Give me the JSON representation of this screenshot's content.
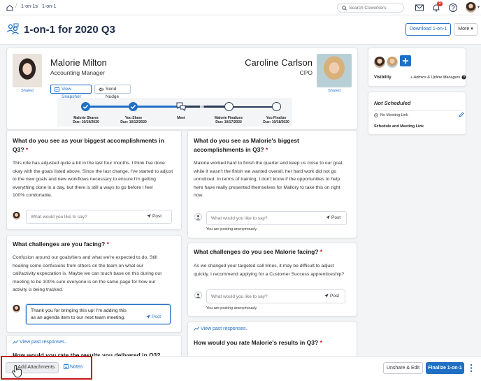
{
  "breadcrumb": {
    "items": [
      "1-on-1s",
      "1-on-1"
    ],
    "separator": "/"
  },
  "topbar": {
    "search_placeholder": "Search Coworkers",
    "notification_count": "2"
  },
  "page": {
    "title": "1-on-1 for 2020 Q3",
    "download_label": "Download 1-on-1",
    "more_label": "More"
  },
  "participants": {
    "left": {
      "name": "Malorie Milton",
      "role": "Accounting Manager",
      "shared_label": "Shared",
      "view_snapshot_label": "View Snapshot",
      "send_nudge_label": "Send Nudge"
    },
    "right": {
      "name": "Caroline Carlson",
      "role": "CPO",
      "shared_label": "Shared"
    }
  },
  "steps": [
    {
      "label": "Malorie Shares",
      "due": "Due: 10/19/2020",
      "state": "done"
    },
    {
      "label": "You Share",
      "due": "Due: 10/12/2020",
      "state": "done"
    },
    {
      "label": "Meet",
      "due": "",
      "state": "current"
    },
    {
      "label": "Malorie Finalizes",
      "due": "Due: 10/17/2020",
      "state": "todo"
    },
    {
      "label": "You Finalize",
      "due": "Due: 10/18/2020",
      "state": "todo"
    }
  ],
  "sidebar": {
    "visibility_label": "Visibility",
    "visibility_value": "+ Admins & Upline Managers",
    "not_scheduled_title": "Not Scheduled",
    "no_meeting_link": "No Meeting Link",
    "schedule_link_label": "Schedule and Meeting Link"
  },
  "left_column": {
    "q1": {
      "title_line1": "What do you see as your biggest accomplishments in",
      "title_line2": "Q3?",
      "required_mark": "*",
      "answer_lines": [
        "This role has adjusted quite a bit in the last four months. I think I've done",
        "okay with the goals listed above. Since the last change, I've started to adjust",
        "to the new goals and new workflows necessary to ensure I'm getting",
        "everything done in a day, but there is still a ways to go before I feel",
        "100% comfortable."
      ],
      "comment_placeholder": "What would you like to say?",
      "post_label": "Post"
    },
    "q2": {
      "title": "What challenges are you facing?",
      "required_mark": "*",
      "answer_lines": [
        "Confusion around our goals/tiers and what we're expected to do. Still",
        "hearing some confusions from others on the team on what our",
        "call/activity expectation is. Maybe we can touch base on this during our",
        "meeting to be 100% sure everyone is on the same page for how our",
        "activity is being tracked."
      ],
      "comment_lines": [
        "Thank you for bringing this up! I'm adding this",
        "as an agenda item to our next team meeting."
      ],
      "post_label": "Post"
    },
    "view_past_label": "View past responses.",
    "q3_title": "How would you rate the results you delivered in Q3?"
  },
  "right_column": {
    "q1": {
      "title_line1": "What do you see as Malorie's biggest",
      "title_line2": "accomplishments in Q3?",
      "required_mark": "*",
      "answer_lines": [
        "Malorie worked hard to finish the quarter and keep us close to our goal,",
        "while it wasn't the finish we wanted overall, her hard work did not go",
        "unnoticed. In terms of training, I don't know if the opportunities to help",
        "here have really presented themselves for Mallory to take this on right",
        "now."
      ],
      "comment_placeholder": "What would you like to say?",
      "post_label": "Post",
      "anon_note": "You are posting anonymously."
    },
    "q2": {
      "title": "What challenges do you see Malorie facing?",
      "required_mark": "*",
      "answer_lines": [
        "As we changed your targeted call times, it may be difficult to adjust",
        "quickly. I recommend applying for a Customer Success apprenticeship?"
      ],
      "comment_placeholder": "What would you like to say?",
      "post_label": "Post",
      "anon_note": "You are posting anonymously."
    },
    "view_past_label": "View past responses.",
    "q3_title": "How would you rate Malorie's results in Q3?",
    "q3_required_mark": "*"
  },
  "bottom": {
    "add_attachments_label": "Add Attachments",
    "notes_label": "Notes",
    "unshare_label": "Unshare & Edit",
    "finalize_label": "Finalize 1-on-1"
  },
  "colors": {
    "accent": "#1f6fc5",
    "header_text": "#1b2b48",
    "highlight_frame": "#c4161c"
  }
}
